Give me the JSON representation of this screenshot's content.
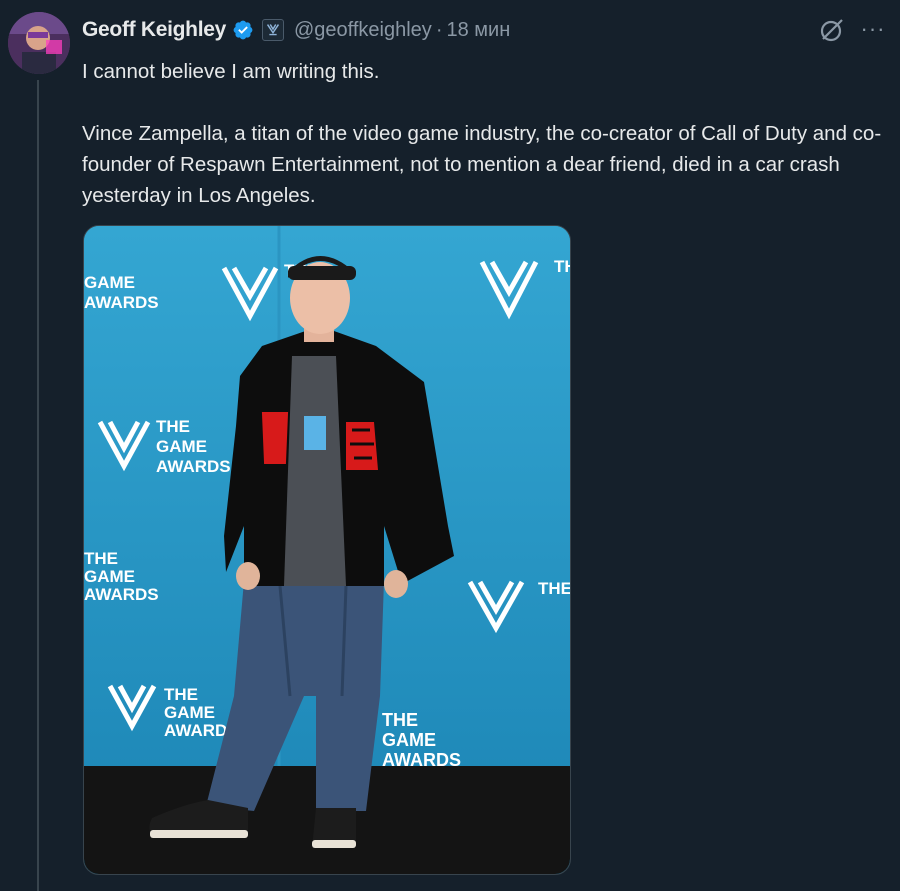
{
  "author": {
    "name": "Geoff Keighley",
    "handle": "@geoffkeighley",
    "separator": "·",
    "time": "18 мин"
  },
  "tweet": {
    "line1": "I cannot believe I am writing this.",
    "line2": "Vince Zampella, a titan of the video game industry, the co-creator of Call of Duty and co-founder of Respawn Entertainment, not to mention a dear friend, died in a car crash yesterday in Los Angeles."
  },
  "actions": {
    "more": "···"
  },
  "media": {
    "backdrop_logo_lines": [
      "THE",
      "GAME",
      "AWARDS"
    ]
  },
  "colors": {
    "background": "#15202b",
    "text": "#e7e9ea",
    "secondary": "#8b98a5",
    "verified": "#1d9bf0",
    "backdrop": "#2fa0cc"
  }
}
